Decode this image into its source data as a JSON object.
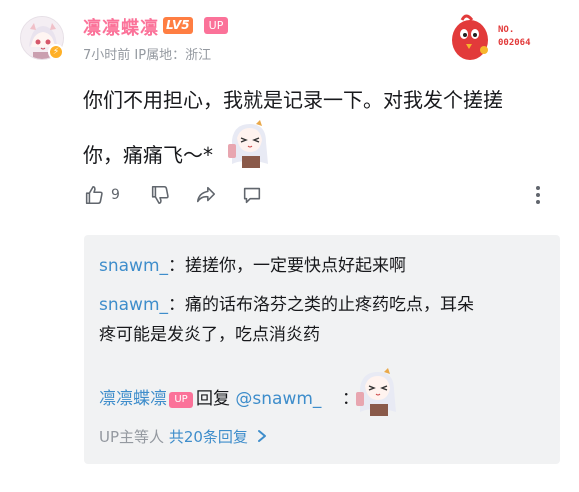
{
  "comment": {
    "username": "凛凛蝶凛",
    "level_badge": "LV5",
    "up_badge": "UP",
    "time": "7小时前",
    "location": "IP属地：浙江",
    "fan_number": "NO.\n002064",
    "text_line1": "你们不用担心，我就是记录一下。对我发个搓搓",
    "text_line2": "你，痛痛飞～*",
    "like_count": "9",
    "colors": {
      "username": "#fb7299",
      "link": "#3e8dcb",
      "level": "#ff7e42",
      "gray": "#9499a0"
    }
  },
  "icons": {
    "like": "thumb-up-icon",
    "dislike": "thumb-down-icon",
    "share": "share-icon",
    "reply": "comment-bubble-icon",
    "more": "more-vertical-icon"
  },
  "replies": {
    "items": [
      {
        "name": "snawm_",
        "sep": "：",
        "text": "搓搓你，一定要快点好起来啊"
      },
      {
        "name": "snawm_",
        "sep": "：",
        "text": "痛的话布洛芬之类的止疼药吃点，耳朵",
        "text_cont": "疼可能是发炎了，吃点消炎药"
      }
    ],
    "up_reply": {
      "name": "凛凛蝶凛",
      "up_badge": "UP",
      "action": "回复",
      "mention": "@snawm_",
      "sep": "："
    },
    "summary_prefix": "UP主等人",
    "summary_count": "共20条回复"
  }
}
